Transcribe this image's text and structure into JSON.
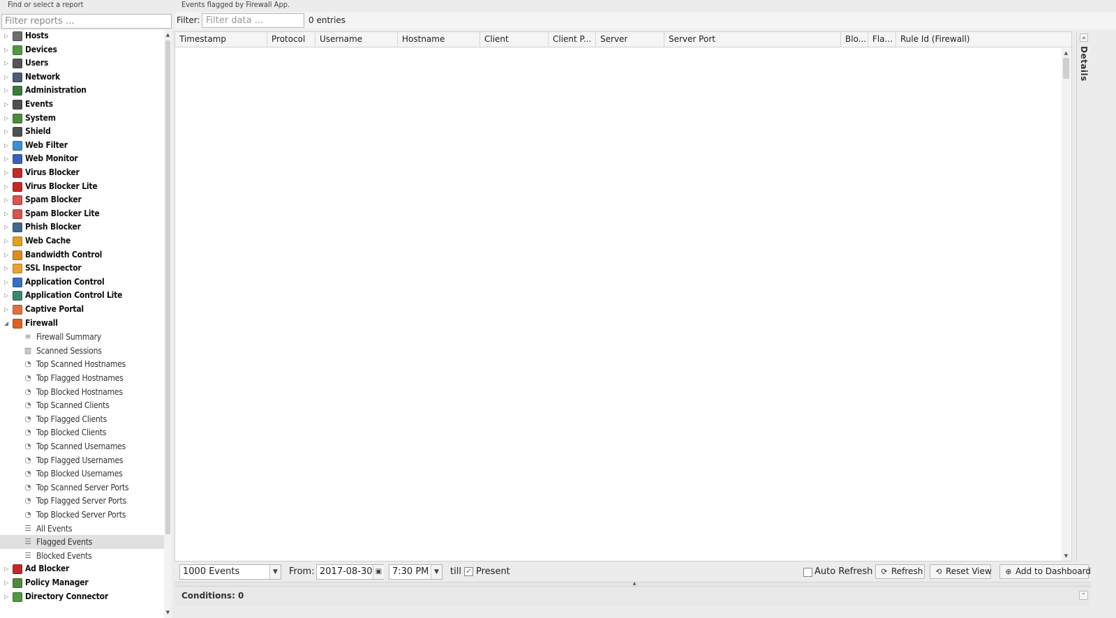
{
  "left_panel": {
    "title": "Find or select a report",
    "filter_placeholder": "Filter reports ..."
  },
  "tree": {
    "categories_top": [
      {
        "label": "Hosts",
        "icon": "hosts-icon",
        "color": "#6d6d6d"
      },
      {
        "label": "Devices",
        "icon": "devices-icon",
        "color": "#4f9a3d"
      },
      {
        "label": "Users",
        "icon": "users-icon",
        "color": "#555555"
      },
      {
        "label": "Network",
        "icon": "network-icon",
        "color": "#4b5d73"
      },
      {
        "label": "Administration",
        "icon": "administration-icon",
        "color": "#3a7a3a"
      },
      {
        "label": "Events",
        "icon": "events-icon",
        "color": "#505050"
      },
      {
        "label": "System",
        "icon": "system-icon",
        "color": "#4f8a3a"
      },
      {
        "label": "Shield",
        "icon": "shield-icon",
        "color": "#505050"
      },
      {
        "label": "Web Filter",
        "icon": "web-filter-icon",
        "color": "#3b8fd6"
      },
      {
        "label": "Web Monitor",
        "icon": "web-monitor-icon",
        "color": "#3b5fc0"
      },
      {
        "label": "Virus Blocker",
        "icon": "virus-blocker-icon",
        "color": "#c62828"
      },
      {
        "label": "Virus Blocker Lite",
        "icon": "virus-blocker-lite-icon",
        "color": "#c62828"
      },
      {
        "label": "Spam Blocker",
        "icon": "spam-blocker-icon",
        "color": "#d9534f"
      },
      {
        "label": "Spam Blocker Lite",
        "icon": "spam-blocker-lite-icon",
        "color": "#d9534f"
      },
      {
        "label": "Phish Blocker",
        "icon": "phish-blocker-icon",
        "color": "#3f6a8a"
      },
      {
        "label": "Web Cache",
        "icon": "web-cache-icon",
        "color": "#e0a020"
      },
      {
        "label": "Bandwidth Control",
        "icon": "bandwidth-control-icon",
        "color": "#e08a20"
      },
      {
        "label": "SSL Inspector",
        "icon": "ssl-inspector-icon",
        "color": "#f0a030"
      },
      {
        "label": "Application Control",
        "icon": "application-control-icon",
        "color": "#3a6fc0"
      },
      {
        "label": "Application Control Lite",
        "icon": "application-control-lite-icon",
        "color": "#3a8a6a"
      },
      {
        "label": "Captive Portal",
        "icon": "captive-portal-icon",
        "color": "#e07040"
      },
      {
        "label": "Firewall",
        "icon": "firewall-icon",
        "color": "#e06020",
        "expanded": true
      }
    ],
    "firewall_reports": [
      {
        "label": "Firewall Summary",
        "icon": "text-lines-icon",
        "glyph": "≡"
      },
      {
        "label": "Scanned Sessions",
        "icon": "bar-chart-icon",
        "glyph": "▥"
      },
      {
        "label": "Top Scanned Hostnames",
        "icon": "pie-chart-icon",
        "glyph": "◔"
      },
      {
        "label": "Top Flagged Hostnames",
        "icon": "pie-chart-icon",
        "glyph": "◔"
      },
      {
        "label": "Top Blocked Hostnames",
        "icon": "pie-chart-icon",
        "glyph": "◔"
      },
      {
        "label": "Top Scanned Clients",
        "icon": "pie-chart-icon",
        "glyph": "◔"
      },
      {
        "label": "Top Flagged Clients",
        "icon": "pie-chart-icon",
        "glyph": "◔"
      },
      {
        "label": "Top Blocked Clients",
        "icon": "pie-chart-icon",
        "glyph": "◔"
      },
      {
        "label": "Top Scanned Usernames",
        "icon": "pie-chart-icon",
        "glyph": "◔"
      },
      {
        "label": "Top Flagged Usernames",
        "icon": "pie-chart-icon",
        "glyph": "◔"
      },
      {
        "label": "Top Blocked Usernames",
        "icon": "pie-chart-icon",
        "glyph": "◔"
      },
      {
        "label": "Top Scanned Server Ports",
        "icon": "pie-chart-icon",
        "glyph": "◔"
      },
      {
        "label": "Top Flagged Server Ports",
        "icon": "pie-chart-icon",
        "glyph": "◔"
      },
      {
        "label": "Top Blocked Server Ports",
        "icon": "pie-chart-icon",
        "glyph": "◔"
      },
      {
        "label": "All Events",
        "icon": "list-icon",
        "glyph": "☰"
      },
      {
        "label": "Flagged Events",
        "icon": "list-icon",
        "glyph": "☰",
        "selected": true
      },
      {
        "label": "Blocked Events",
        "icon": "list-icon",
        "glyph": "☰"
      }
    ],
    "categories_bottom": [
      {
        "label": "Ad Blocker",
        "icon": "ad-blocker-icon",
        "color": "#c62828"
      },
      {
        "label": "Policy Manager",
        "icon": "policy-manager-icon",
        "color": "#4f8a3a"
      },
      {
        "label": "Directory Connector",
        "icon": "directory-connector-icon",
        "color": "#4f9a3d"
      }
    ]
  },
  "main": {
    "description": "Events flagged by Firewall App.",
    "filter_label": "Filter:",
    "filter_placeholder": "Filter data ...",
    "entries": "0 entries",
    "columns": [
      "Timestamp",
      "Protocol",
      "Username",
      "Hostname",
      "Client",
      "Client P...",
      "Server",
      "Server Port",
      "Blo...",
      "Fla...",
      "Rule Id (Firewall)"
    ]
  },
  "details": {
    "label": "Details"
  },
  "toolbar": {
    "events_select": "1000 Events",
    "from_label": "From:",
    "from_date": "2017-08-30",
    "from_time": "7:30 PM",
    "till_label": "till",
    "present_label": "Present",
    "present_checked": true,
    "auto_refresh_label": "Auto Refresh",
    "auto_refresh_checked": false,
    "refresh_label": "Refresh",
    "reset_view_label": "Reset View",
    "add_dashboard_label": "Add to Dashboard"
  },
  "conditions": {
    "label": "Conditions: 0"
  }
}
